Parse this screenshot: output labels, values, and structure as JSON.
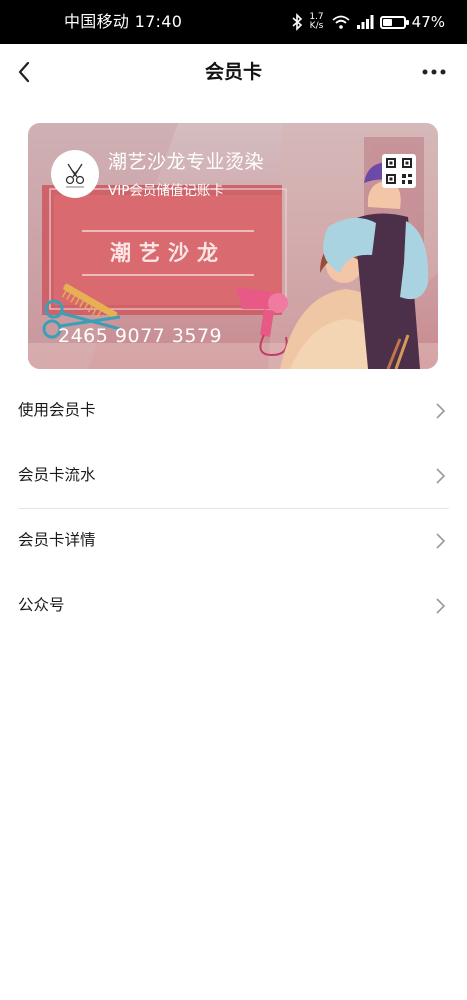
{
  "status_bar": {
    "carrier_time": "中国移动 17:40",
    "net_speed_value": "1.7",
    "net_speed_unit": "K/s",
    "battery": "47%",
    "battery_level": 0.47
  },
  "nav": {
    "title": "会员卡"
  },
  "card": {
    "shop_name": "潮艺沙龙专业烫染",
    "card_type": "VIP会员储值记账卡",
    "brand": "潮艺沙龙",
    "number": "2465 9077 3579",
    "colors": {
      "top": "#d4bdc0",
      "bottom": "#c78a8f",
      "panel": "#d9646a"
    }
  },
  "menu": {
    "items": [
      {
        "label": "使用会员卡",
        "icon": "chevron-right-icon"
      },
      {
        "label": "会员卡流水",
        "icon": "chevron-right-icon"
      },
      {
        "label": "会员卡详情",
        "icon": "chevron-right-icon"
      },
      {
        "label": "公众号",
        "icon": "chevron-right-icon"
      }
    ]
  }
}
